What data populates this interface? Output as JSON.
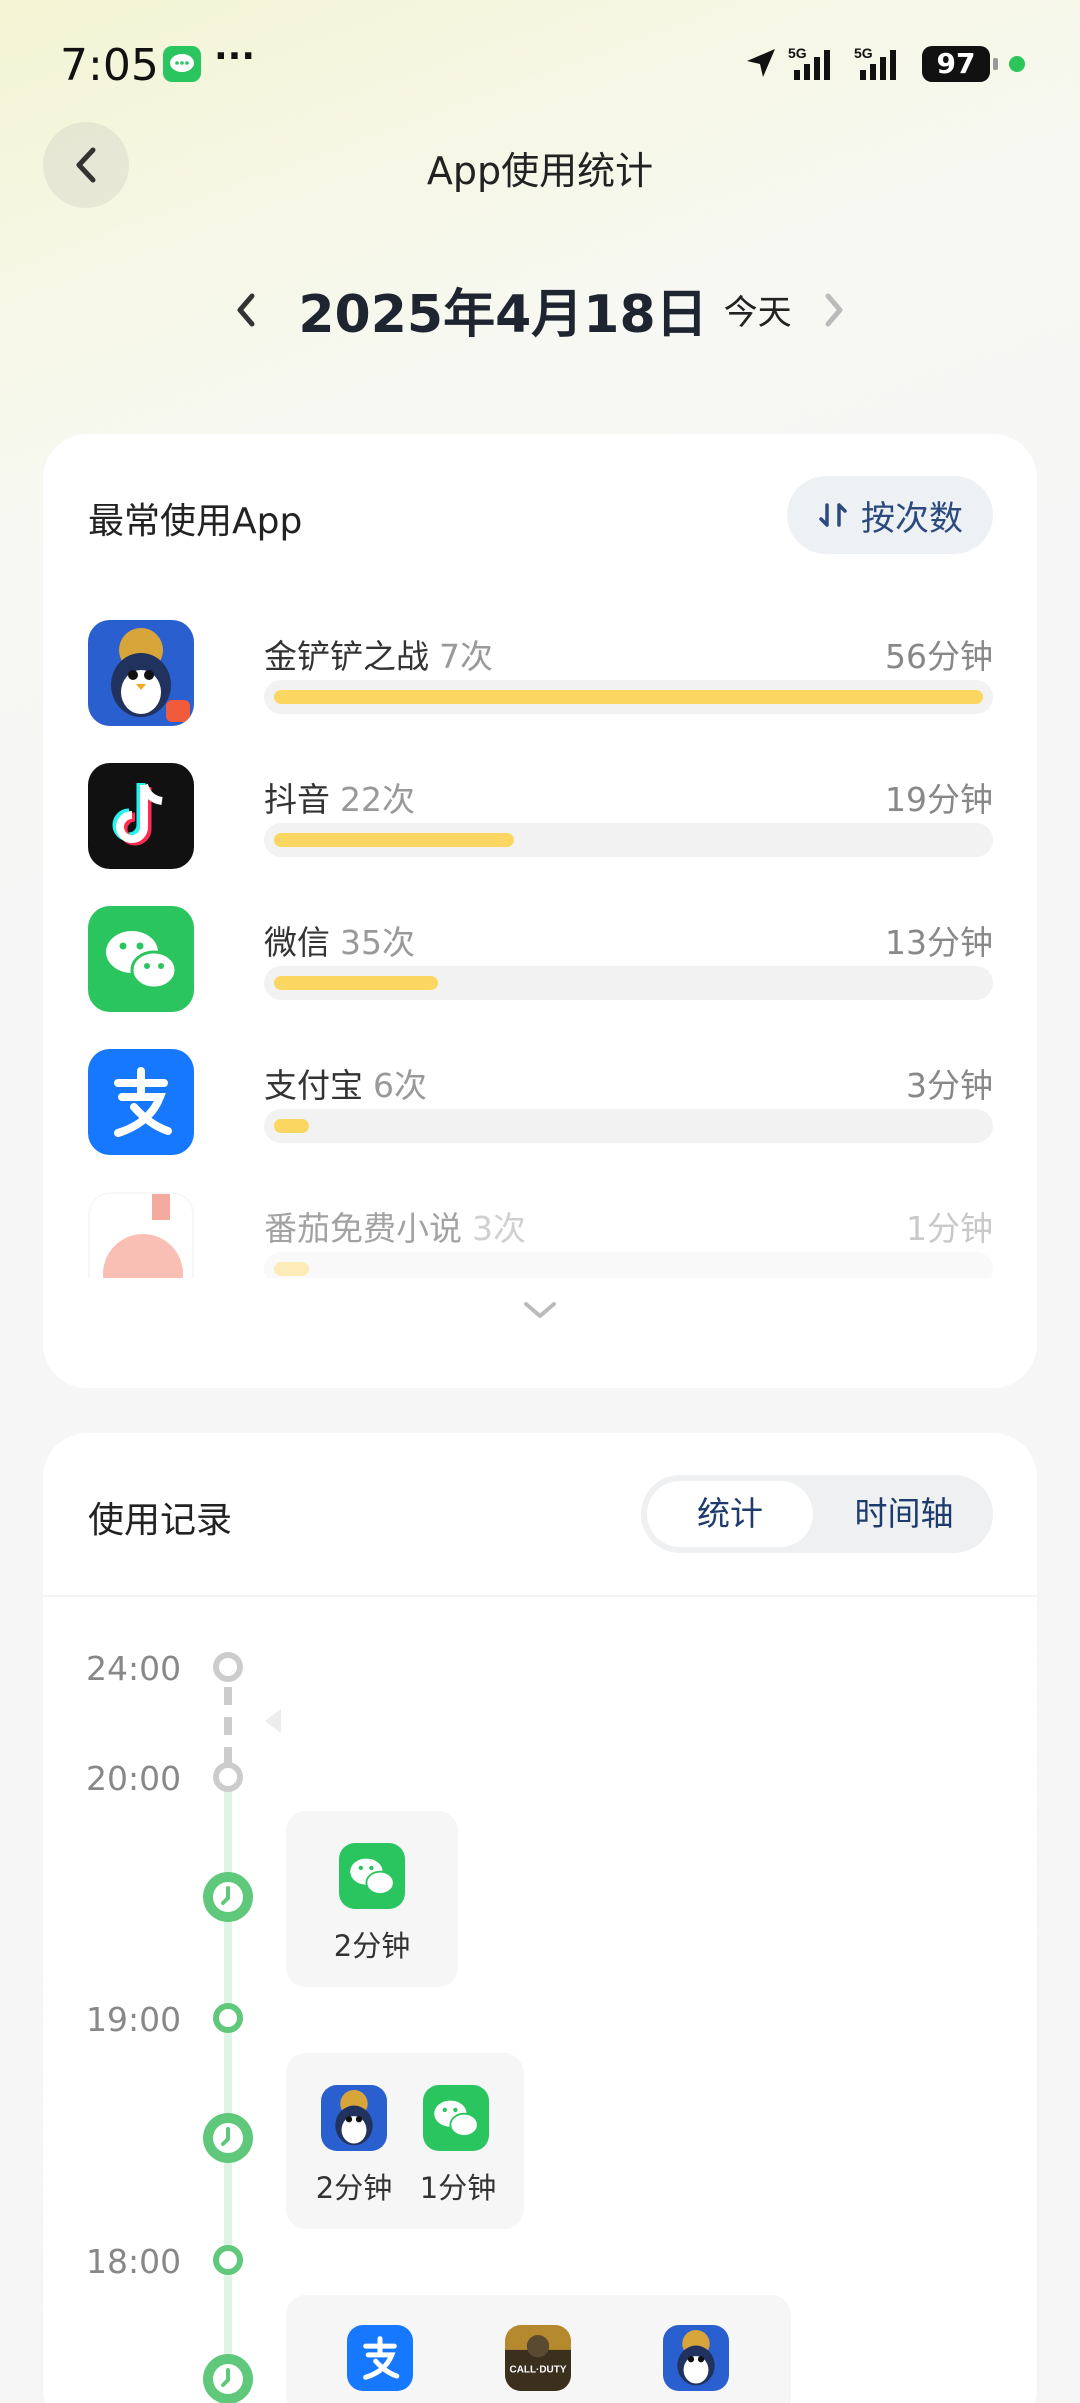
{
  "status": {
    "time": "7:05",
    "dots": "···",
    "sig1": "5G",
    "sig2": "5G",
    "battery": "97"
  },
  "header": {
    "title": "App使用统计"
  },
  "date": {
    "main": "2025年4月18日",
    "today": "今天"
  },
  "most_used": {
    "title": "最常使用App",
    "sort_label": "按次数",
    "apps": [
      {
        "name": "金铲铲之战",
        "count": "7次",
        "time": "56分钟",
        "fill": 1.0
      },
      {
        "name": "抖音",
        "count": "22次",
        "time": "19分钟",
        "fill": 0.339
      },
      {
        "name": "微信",
        "count": "35次",
        "time": "13分钟",
        "fill": 0.232
      },
      {
        "name": "支付宝",
        "count": "6次",
        "time": "3分钟",
        "fill": 0.05
      },
      {
        "name": "番茄免费小说",
        "count": "3次",
        "time": "1分钟",
        "fill": 0.05
      }
    ]
  },
  "records": {
    "title": "使用记录",
    "tab_stats": "统计",
    "tab_timeline": "时间轴",
    "hours": [
      "24:00",
      "20:00",
      "19:00",
      "18:00"
    ],
    "entries": [
      {
        "items": [
          {
            "app": "微信",
            "time": "2分钟"
          }
        ]
      },
      {
        "items": [
          {
            "app": "金铲铲之战",
            "time": "2分钟"
          },
          {
            "app": "微信",
            "time": "1分钟"
          }
        ]
      },
      {
        "items": [
          {
            "app": "支付宝"
          },
          {
            "app": "使命召唤"
          },
          {
            "app": "金铲铲之战"
          }
        ]
      }
    ]
  }
}
